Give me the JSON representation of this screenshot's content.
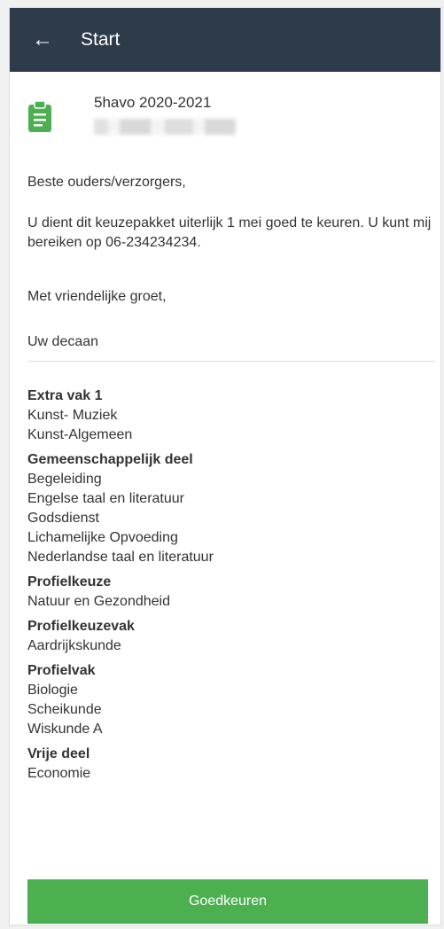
{
  "appbar": {
    "back_icon": "arrow-left-icon",
    "title": "Start"
  },
  "header": {
    "icon": "clipboard-icon",
    "title": "5havo 2020-2021"
  },
  "message": {
    "p1": "Beste ouders/verzorgers,",
    "p2": "U dient dit keuzepakket uiterlijk 1 mei goed te keuren. U kunt mij bereiken op 06-234234234.",
    "p3": "Met vriendelijke groet,",
    "p4": "Uw decaan"
  },
  "groups": [
    {
      "title": "Extra vak 1",
      "items": [
        "Kunst- Muziek",
        "Kunst-Algemeen"
      ]
    },
    {
      "title": "Gemeenschappelijk deel",
      "items": [
        "Begeleiding",
        "Engelse taal en literatuur",
        "Godsdienst",
        "Lichamelijke Opvoeding",
        "Nederlandse taal en literatuur"
      ]
    },
    {
      "title": "Profielkeuze",
      "items": [
        "Natuur en Gezondheid"
      ]
    },
    {
      "title": "Profielkeuzevak",
      "items": [
        "Aardrijkskunde"
      ]
    },
    {
      "title": "Profielvak",
      "items": [
        "Biologie",
        "Scheikunde",
        "Wiskunde A"
      ]
    },
    {
      "title": "Vrije deel",
      "items": [
        "Economie"
      ]
    }
  ],
  "actions": {
    "approve_label": "Goedkeuren"
  },
  "colors": {
    "appbar": "#2e3b4a",
    "accent": "#4caf50"
  }
}
